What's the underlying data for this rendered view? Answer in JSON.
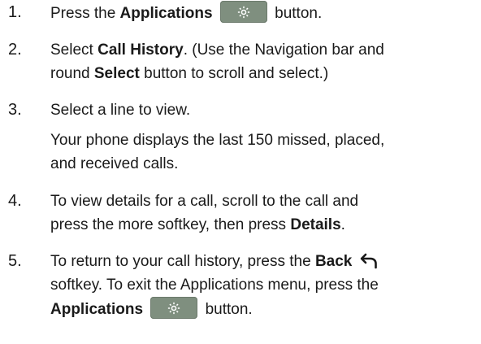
{
  "steps": [
    {
      "num": "1.",
      "t1": "Press the ",
      "b1": "Applications",
      "t2": " button."
    },
    {
      "num": "2.",
      "t1": "Select ",
      "b1": "Call History",
      "t2": ". (Use the Navigation bar and",
      "t3": "round ",
      "b2": "Select",
      "t4": " button to scroll and select.)"
    },
    {
      "num": "3.",
      "t1": "Select a line to view.",
      "t2": "Your phone displays the last 150 missed, placed,",
      "t3": "and received calls."
    },
    {
      "num": "4.",
      "t1": "To view details for a call, scroll to the call and",
      "t2": "press the more softkey, then press ",
      "b1": "Details",
      "t3": "."
    },
    {
      "num": "5.",
      "t1": "To return to your call history, press the ",
      "b1": "Back",
      "t2": "softkey. To exit the Applications menu, press the",
      "b2": "Applications",
      "t3": " button."
    }
  ],
  "icons": {
    "applications": "gear-icon",
    "back": "back-arrow-icon"
  },
  "colors": {
    "text": "#1a1a1a",
    "button_fill": "#7f8f7f",
    "icon_stroke": "#ffffff"
  }
}
